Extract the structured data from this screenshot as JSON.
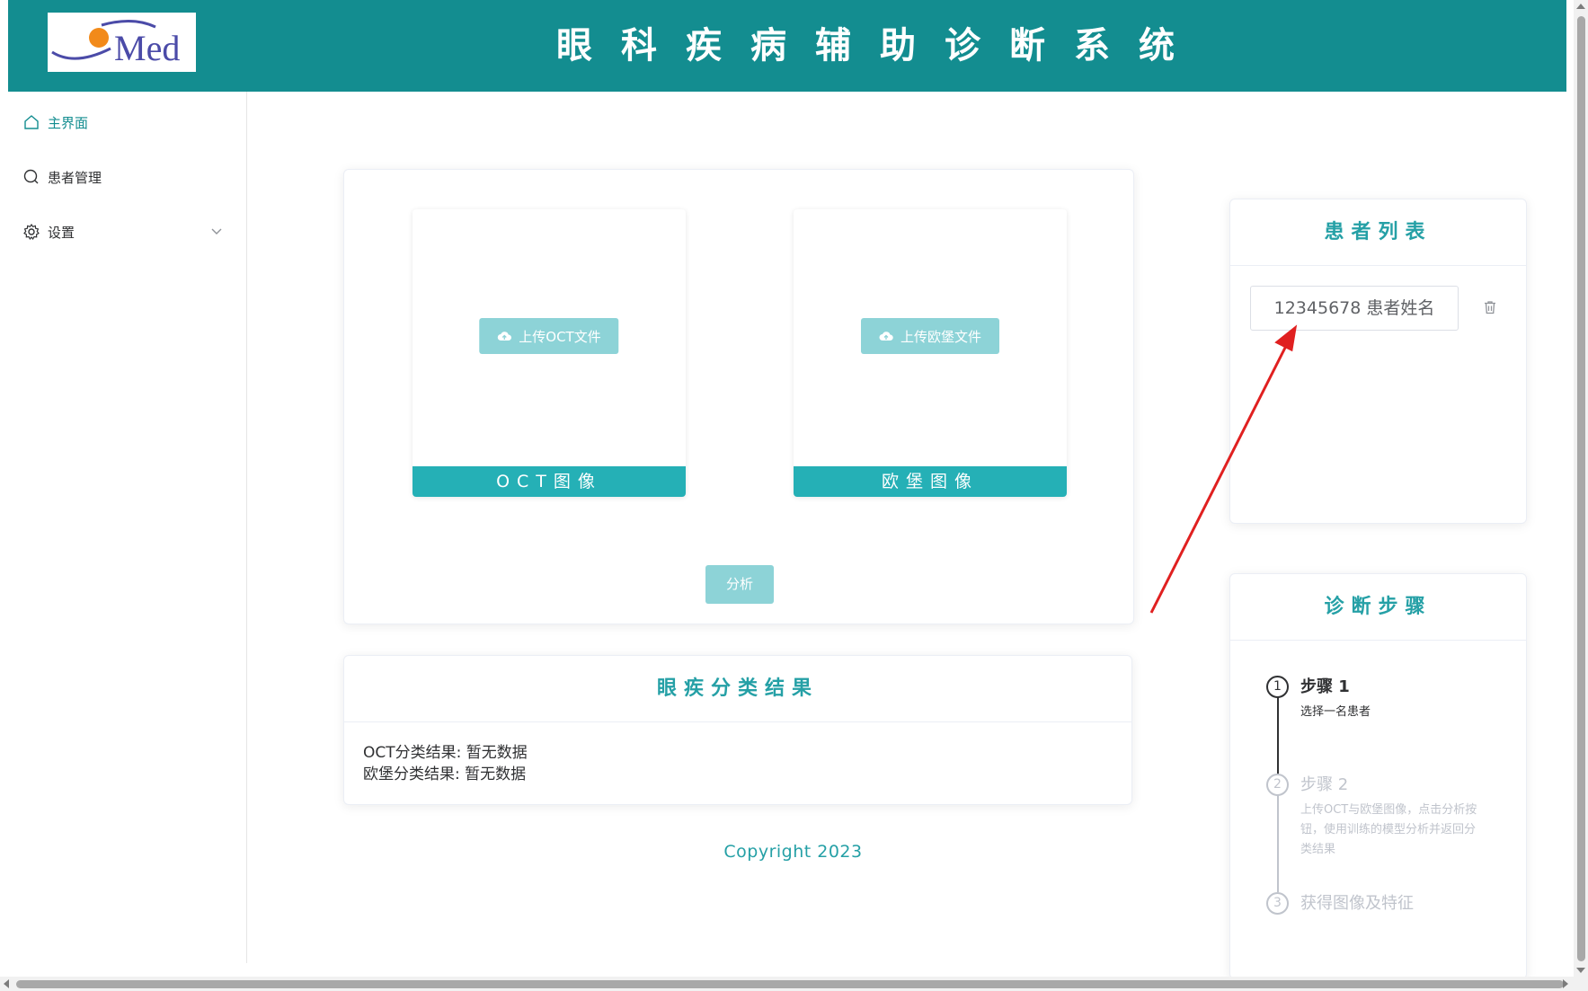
{
  "header": {
    "logo_text": "Med",
    "title": "眼科疾病辅助诊断系统"
  },
  "sidebar": {
    "items": [
      {
        "label": "主界面",
        "icon": "home-icon",
        "active": true
      },
      {
        "label": "患者管理",
        "icon": "search-icon",
        "active": false
      },
      {
        "label": "设置",
        "icon": "gear-icon",
        "active": false,
        "has_submenu": true
      }
    ]
  },
  "upload": {
    "oct": {
      "button_label": "上传OCT文件",
      "caption": "OCT图像"
    },
    "fundus": {
      "button_label": "上传欧堡文件",
      "caption": "欧堡图像"
    },
    "analyze_label": "分析"
  },
  "results": {
    "title": "眼疾分类结果",
    "oct_line": "OCT分类结果: 暂无数据",
    "fundus_line": "欧堡分类结果: 暂无数据"
  },
  "footer": {
    "copyright": "Copyright 2023"
  },
  "patients": {
    "title": "患者列表",
    "items": [
      {
        "label": "12345678 患者姓名"
      }
    ]
  },
  "steps": {
    "title": "诊断步骤",
    "items": [
      {
        "num": "1",
        "title": "步骤 1",
        "desc": "选择一名患者",
        "status": "process"
      },
      {
        "num": "2",
        "title": "步骤 2",
        "desc": "上传OCT与欧堡图像，点击分析按钮，使用训练的模型分析并返回分类结果",
        "status": "wait"
      },
      {
        "num": "3",
        "title": "获得图像及特征",
        "desc": "",
        "status": "wait"
      }
    ]
  },
  "colors": {
    "header_bg": "#138d90",
    "accent": "#25b0b6",
    "accent_text": "#25a0a6",
    "disabled_button": "#8dd3d7",
    "annotation_arrow": "#e02020"
  }
}
